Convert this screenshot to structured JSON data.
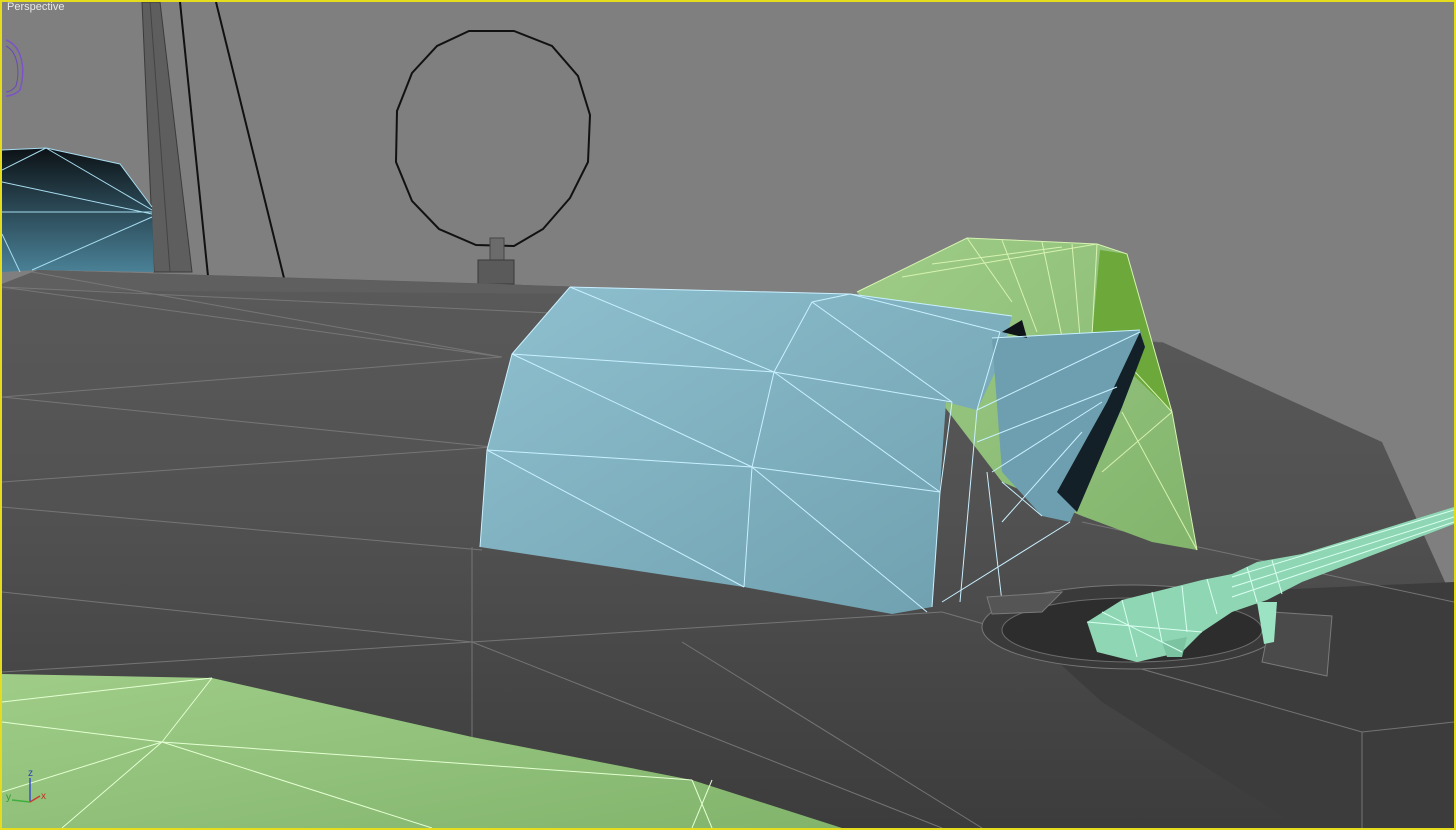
{
  "viewport": {
    "label": "Perspective",
    "active_border_color": "#e6dc1e",
    "background_color": "#7f7f7f"
  },
  "axis_tripod": {
    "x_label": "x",
    "y_label": "y",
    "z_label": "z",
    "x_color": "#d03a2a",
    "y_color": "#3fae3f",
    "z_color": "#3a4fd0"
  },
  "objects": {
    "canopy_color": "#8ab8c6",
    "gunner_shield_color": "#8db768",
    "machine_gun_color": "#8fd7b4",
    "wing_color": "#9aca82",
    "fuselage_color": "#4f4f4f"
  },
  "icons": {
    "gizmo": "selection-ring-icon",
    "axis": "axis-tripod-icon"
  }
}
